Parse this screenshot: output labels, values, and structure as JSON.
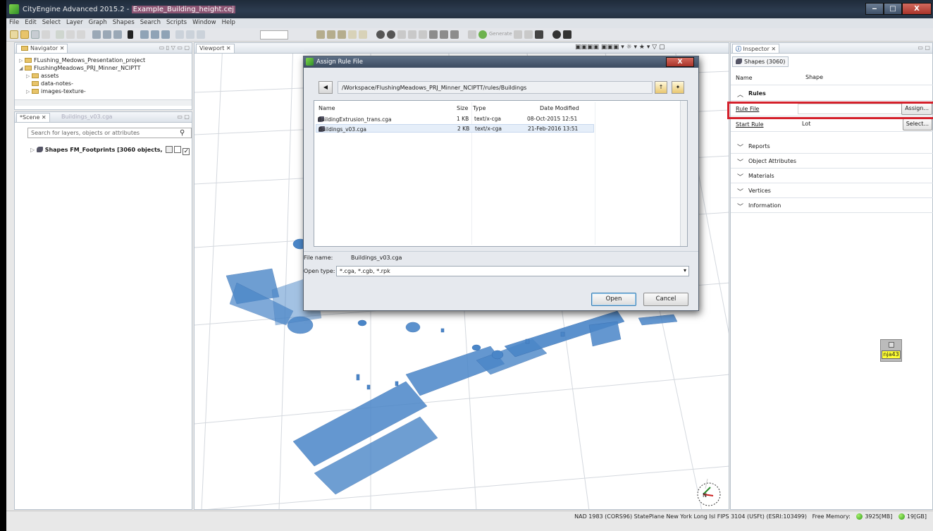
{
  "window": {
    "title_prefix": "CityEngine Advanced 2015.2 - ",
    "title_file": "Example_Building_height.cej",
    "min": "‒",
    "max": "□",
    "close": "X"
  },
  "menu": [
    "File",
    "Edit",
    "Select",
    "Layer",
    "Graph",
    "Shapes",
    "Search",
    "Scripts",
    "Window",
    "Help"
  ],
  "toolbar": {
    "generate_label": "Generate"
  },
  "navigator": {
    "tab": "Navigator",
    "items": [
      {
        "label": "FLushing_Medows_Presentation_project"
      },
      {
        "label": "FlushingMeadows_PRJ_Minner_NCIPTT"
      },
      {
        "label": "assets"
      },
      {
        "label": "data-notes-"
      },
      {
        "label": "images-texture-"
      }
    ]
  },
  "scene": {
    "tab_scene": "*Scene",
    "tab_rule": "Buildings_v03.cga",
    "search_placeholder": "Search for layers, objects or attributes",
    "layer": "Shapes FM_Footprints [3060 objects,"
  },
  "viewport": {
    "tab": "Viewport"
  },
  "inspector": {
    "tab": "Inspector",
    "subtab": "Shapes (3060)",
    "name_label": "Name",
    "name_value": "Shape",
    "rules_header": "Rules",
    "rule_file_label": "Rule File",
    "rule_file_button": "Assign...",
    "start_rule_label": "Start Rule",
    "start_rule_value": "Lot",
    "start_rule_button": "Select...",
    "sections": [
      "Reports",
      "Object Attributes",
      "Materials",
      "Vertices",
      "Information"
    ]
  },
  "sticky": {
    "label": "nja43"
  },
  "status": {
    "projection": "NAD 1983 (CORS96) StatePlane New York Long Isl FIPS 3104 (USFt) (ESRI:103499)",
    "free_memory_label": "Free Memory:",
    "memory": "3925[MB]",
    "disk": "19[GB]"
  },
  "dialog": {
    "title": "Assign Rule File",
    "close": "X",
    "path": "/Workspace/FlushingMeadows_PRJ_Minner_NCIPTT/rules/Buildings",
    "columns": [
      "Name",
      "Size",
      "Type",
      "Date Modified"
    ],
    "files": [
      {
        "name": "BuildingExtrusion_trans.cga",
        "size": "1 KB",
        "type": "text/x-cga",
        "date": "08-Oct-2015 12:51"
      },
      {
        "name": "Buildings_v03.cga",
        "size": "2 KB",
        "type": "text/x-cga",
        "date": "21-Feb-2016 13:51"
      }
    ],
    "file_name_label": "File name:",
    "file_name_value": "Buildings_v03.cga",
    "open_type_label": "Open type:",
    "open_type_value": "*.cga, *.cgb, *.rpk",
    "open_button": "Open",
    "cancel_button": "Cancel"
  }
}
